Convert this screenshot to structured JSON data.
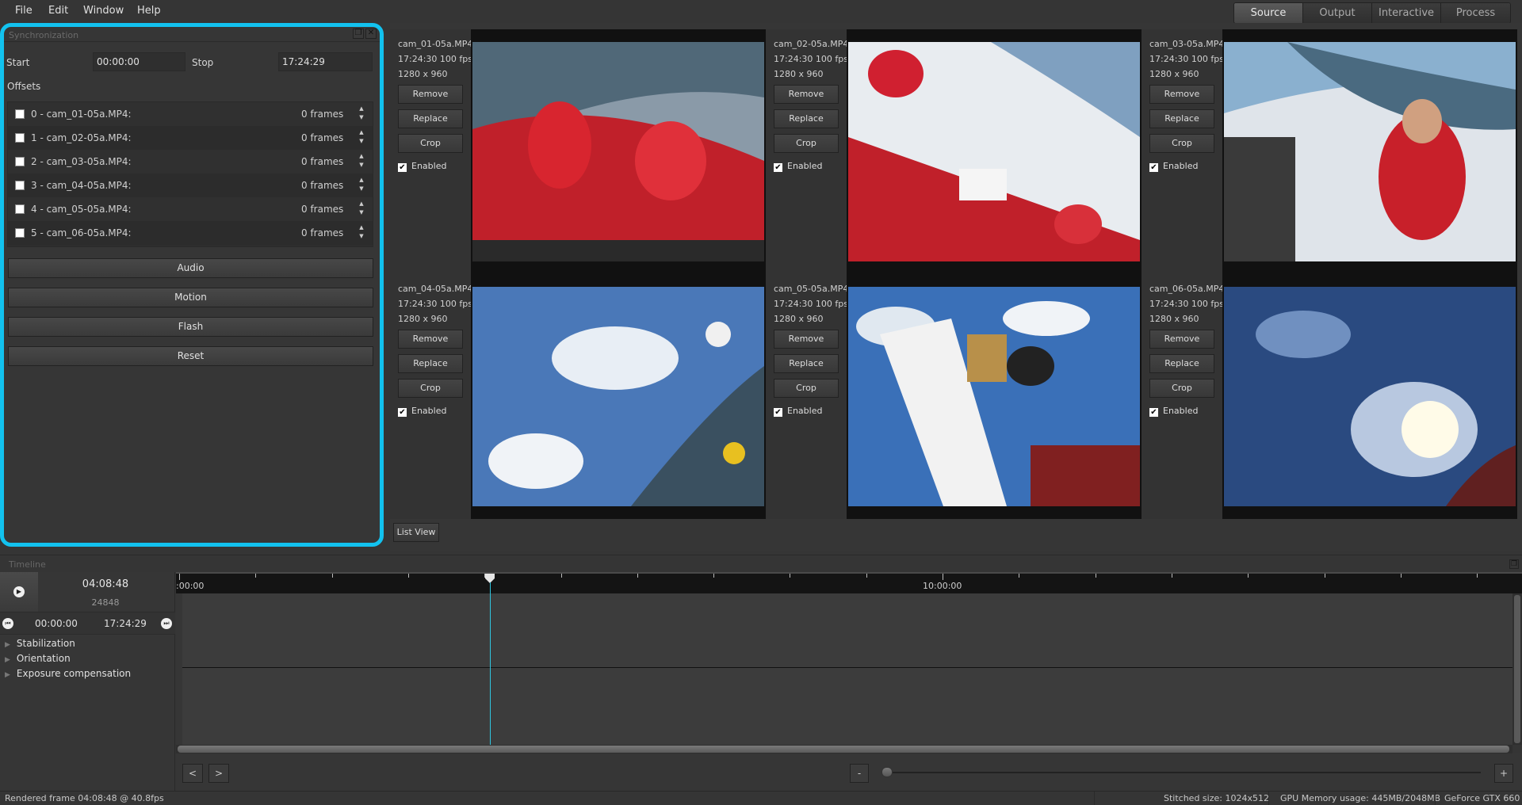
{
  "menu": [
    "File",
    "Edit",
    "Window",
    "Help"
  ],
  "mode_tabs": [
    {
      "label": "Source",
      "active": true
    },
    {
      "label": "Output",
      "active": false
    },
    {
      "label": "Interactive",
      "active": false
    },
    {
      "label": "Process",
      "active": false
    }
  ],
  "sync": {
    "title": "Synchronization",
    "start_label": "Start",
    "start_value": "00:00:00",
    "stop_label": "Stop",
    "stop_value": "17:24:29",
    "offsets_label": "Offsets",
    "offsets": [
      {
        "name": "0 - cam_01-05a.MP4:",
        "value": "0 frames",
        "checked": false
      },
      {
        "name": "1 - cam_02-05a.MP4:",
        "value": "0 frames",
        "checked": false
      },
      {
        "name": "2 - cam_03-05a.MP4:",
        "value": "0 frames",
        "checked": false
      },
      {
        "name": "3 - cam_04-05a.MP4:",
        "value": "0 frames",
        "checked": false
      },
      {
        "name": "4 - cam_05-05a.MP4:",
        "value": "0 frames",
        "checked": false
      },
      {
        "name": "5 - cam_06-05a.MP4:",
        "value": "0 frames",
        "checked": false
      }
    ],
    "buttons": [
      "Audio",
      "Motion",
      "Flash",
      "Reset"
    ],
    "highlight_color": "#12c2ef"
  },
  "cameras": [
    {
      "file": "cam_01-05a.MP4",
      "meta": "17:24:30 100 fps",
      "res": "1280 x 960",
      "enabled": true,
      "scene": "deck-red"
    },
    {
      "file": "cam_02-05a.MP4",
      "meta": "17:24:30 100 fps",
      "res": "1280 x 960",
      "enabled": true,
      "scene": "deck-white"
    },
    {
      "file": "cam_03-05a.MP4",
      "meta": "17:24:30 100 fps",
      "res": "1280 x 960",
      "enabled": true,
      "scene": "crew"
    },
    {
      "file": "cam_04-05a.MP4",
      "meta": "17:24:30 100 fps",
      "res": "1280 x 960",
      "enabled": true,
      "scene": "sky-sea"
    },
    {
      "file": "cam_05-05a.MP4",
      "meta": "17:24:30 100 fps",
      "res": "1280 x 960",
      "enabled": true,
      "scene": "sail"
    },
    {
      "file": "cam_06-05a.MP4",
      "meta": "17:24:30 100 fps",
      "res": "1280 x 960",
      "enabled": true,
      "scene": "sun"
    }
  ],
  "camera_buttons": {
    "remove": "Remove",
    "replace": "Replace",
    "crop": "Crop",
    "enabled": "Enabled"
  },
  "list_view_label": "List View",
  "timeline": {
    "title": "Timeline",
    "current_time": "04:08:48",
    "current_frame": "24848",
    "range_start": "00:00:00",
    "range_end": "17:24:29",
    "tree": [
      "Stabilization",
      "Orientation",
      "Exposure compensation"
    ],
    "ruler_labels": [
      ":00:00",
      "10:00:00"
    ],
    "playhead_fraction": 0.2394,
    "prev_label": "<",
    "next_label": ">",
    "zoom_minus": "-",
    "zoom_plus": "+",
    "zoom_level": 0
  },
  "status": {
    "left": "Rendered frame 04:08:48 @ 40.8fps",
    "stitched": "Stitched size: 1024x512",
    "gpu_memory": "GPU Memory usage: 445MB/2048MB",
    "gpu": "GeForce GTX 660"
  }
}
